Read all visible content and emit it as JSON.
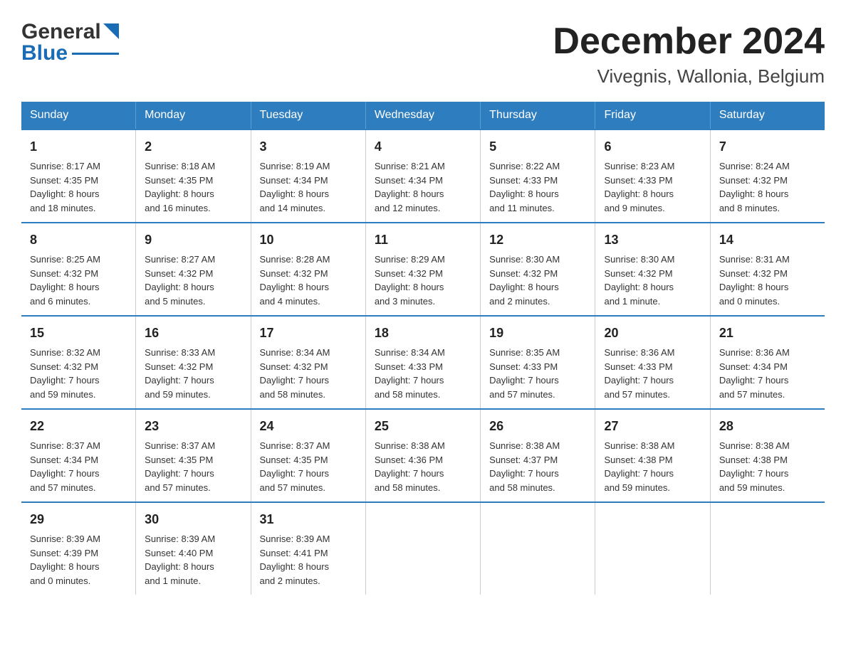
{
  "logo": {
    "general": "General",
    "blue": "Blue"
  },
  "title": "December 2024",
  "subtitle": "Vivegnis, Wallonia, Belgium",
  "days_of_week": [
    "Sunday",
    "Monday",
    "Tuesday",
    "Wednesday",
    "Thursday",
    "Friday",
    "Saturday"
  ],
  "weeks": [
    [
      {
        "day": "1",
        "sunrise": "8:17 AM",
        "sunset": "4:35 PM",
        "daylight": "8 hours and 18 minutes."
      },
      {
        "day": "2",
        "sunrise": "8:18 AM",
        "sunset": "4:35 PM",
        "daylight": "8 hours and 16 minutes."
      },
      {
        "day": "3",
        "sunrise": "8:19 AM",
        "sunset": "4:34 PM",
        "daylight": "8 hours and 14 minutes."
      },
      {
        "day": "4",
        "sunrise": "8:21 AM",
        "sunset": "4:34 PM",
        "daylight": "8 hours and 12 minutes."
      },
      {
        "day": "5",
        "sunrise": "8:22 AM",
        "sunset": "4:33 PM",
        "daylight": "8 hours and 11 minutes."
      },
      {
        "day": "6",
        "sunrise": "8:23 AM",
        "sunset": "4:33 PM",
        "daylight": "8 hours and 9 minutes."
      },
      {
        "day": "7",
        "sunrise": "8:24 AM",
        "sunset": "4:32 PM",
        "daylight": "8 hours and 8 minutes."
      }
    ],
    [
      {
        "day": "8",
        "sunrise": "8:25 AM",
        "sunset": "4:32 PM",
        "daylight": "8 hours and 6 minutes."
      },
      {
        "day": "9",
        "sunrise": "8:27 AM",
        "sunset": "4:32 PM",
        "daylight": "8 hours and 5 minutes."
      },
      {
        "day": "10",
        "sunrise": "8:28 AM",
        "sunset": "4:32 PM",
        "daylight": "8 hours and 4 minutes."
      },
      {
        "day": "11",
        "sunrise": "8:29 AM",
        "sunset": "4:32 PM",
        "daylight": "8 hours and 3 minutes."
      },
      {
        "day": "12",
        "sunrise": "8:30 AM",
        "sunset": "4:32 PM",
        "daylight": "8 hours and 2 minutes."
      },
      {
        "day": "13",
        "sunrise": "8:30 AM",
        "sunset": "4:32 PM",
        "daylight": "8 hours and 1 minute."
      },
      {
        "day": "14",
        "sunrise": "8:31 AM",
        "sunset": "4:32 PM",
        "daylight": "8 hours and 0 minutes."
      }
    ],
    [
      {
        "day": "15",
        "sunrise": "8:32 AM",
        "sunset": "4:32 PM",
        "daylight": "7 hours and 59 minutes."
      },
      {
        "day": "16",
        "sunrise": "8:33 AM",
        "sunset": "4:32 PM",
        "daylight": "7 hours and 59 minutes."
      },
      {
        "day": "17",
        "sunrise": "8:34 AM",
        "sunset": "4:32 PM",
        "daylight": "7 hours and 58 minutes."
      },
      {
        "day": "18",
        "sunrise": "8:34 AM",
        "sunset": "4:33 PM",
        "daylight": "7 hours and 58 minutes."
      },
      {
        "day": "19",
        "sunrise": "8:35 AM",
        "sunset": "4:33 PM",
        "daylight": "7 hours and 57 minutes."
      },
      {
        "day": "20",
        "sunrise": "8:36 AM",
        "sunset": "4:33 PM",
        "daylight": "7 hours and 57 minutes."
      },
      {
        "day": "21",
        "sunrise": "8:36 AM",
        "sunset": "4:34 PM",
        "daylight": "7 hours and 57 minutes."
      }
    ],
    [
      {
        "day": "22",
        "sunrise": "8:37 AM",
        "sunset": "4:34 PM",
        "daylight": "7 hours and 57 minutes."
      },
      {
        "day": "23",
        "sunrise": "8:37 AM",
        "sunset": "4:35 PM",
        "daylight": "7 hours and 57 minutes."
      },
      {
        "day": "24",
        "sunrise": "8:37 AM",
        "sunset": "4:35 PM",
        "daylight": "7 hours and 57 minutes."
      },
      {
        "day": "25",
        "sunrise": "8:38 AM",
        "sunset": "4:36 PM",
        "daylight": "7 hours and 58 minutes."
      },
      {
        "day": "26",
        "sunrise": "8:38 AM",
        "sunset": "4:37 PM",
        "daylight": "7 hours and 58 minutes."
      },
      {
        "day": "27",
        "sunrise": "8:38 AM",
        "sunset": "4:38 PM",
        "daylight": "7 hours and 59 minutes."
      },
      {
        "day": "28",
        "sunrise": "8:38 AM",
        "sunset": "4:38 PM",
        "daylight": "7 hours and 59 minutes."
      }
    ],
    [
      {
        "day": "29",
        "sunrise": "8:39 AM",
        "sunset": "4:39 PM",
        "daylight": "8 hours and 0 minutes."
      },
      {
        "day": "30",
        "sunrise": "8:39 AM",
        "sunset": "4:40 PM",
        "daylight": "8 hours and 1 minute."
      },
      {
        "day": "31",
        "sunrise": "8:39 AM",
        "sunset": "4:41 PM",
        "daylight": "8 hours and 2 minutes."
      },
      {
        "day": "",
        "sunrise": "",
        "sunset": "",
        "daylight": ""
      },
      {
        "day": "",
        "sunrise": "",
        "sunset": "",
        "daylight": ""
      },
      {
        "day": "",
        "sunrise": "",
        "sunset": "",
        "daylight": ""
      },
      {
        "day": "",
        "sunrise": "",
        "sunset": "",
        "daylight": ""
      }
    ]
  ],
  "labels": {
    "sunrise": "Sunrise:",
    "sunset": "Sunset:",
    "daylight": "Daylight:"
  }
}
